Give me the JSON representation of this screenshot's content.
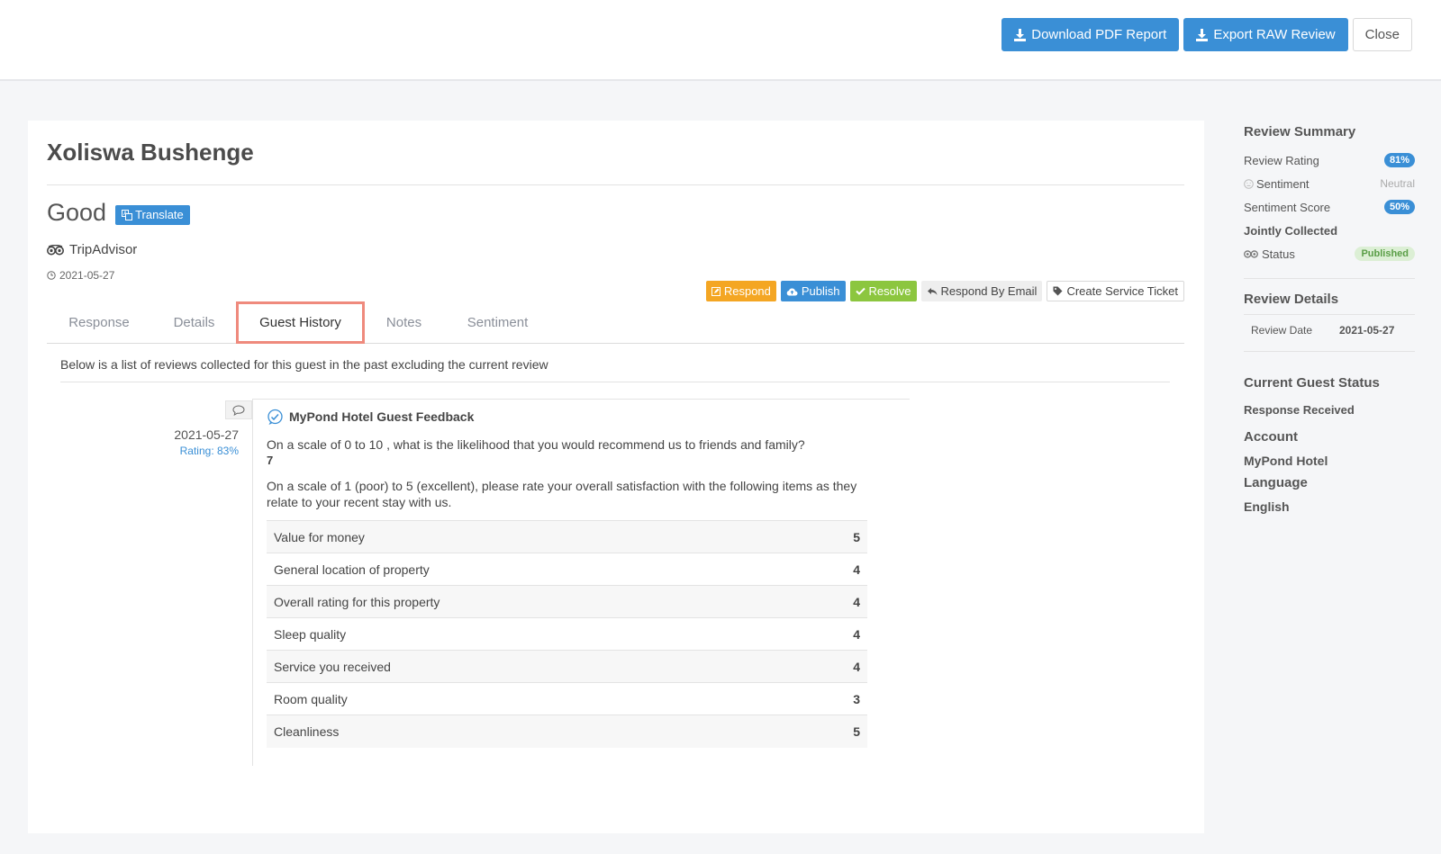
{
  "header": {
    "download_pdf_label": "Download PDF Report",
    "export_raw_label": "Export RAW Review",
    "close_label": "Close"
  },
  "review": {
    "guest_name": "Xoliswa Bushenge",
    "title": "Good",
    "translate_label": "Translate",
    "source": "TripAdvisor",
    "date": "2021-05-27"
  },
  "actions": {
    "respond": "Respond",
    "publish": "Publish",
    "resolve": "Resolve",
    "respond_email": "Respond By Email",
    "service_ticket": "Create Service Ticket"
  },
  "tabs": [
    {
      "label": "Response"
    },
    {
      "label": "Details"
    },
    {
      "label": "Guest History"
    },
    {
      "label": "Notes"
    },
    {
      "label": "Sentiment"
    }
  ],
  "guest_history": {
    "intro": "Below is a list of reviews collected for this guest in the past excluding the current review",
    "date": "2021-05-27",
    "rating": "Rating: 83%",
    "feedback_title": "MyPond Hotel Guest Feedback",
    "q1": "On a scale of 0 to 10 , what is the likelihood that you would recommend us to friends and family?",
    "a1": "7",
    "q2": "On a scale of 1 (poor) to 5 (excellent), please rate your overall satisfaction with the following items as they relate to your recent stay with us.",
    "ratings": [
      {
        "label": "Value for money",
        "value": "5"
      },
      {
        "label": "General location of property",
        "value": "4"
      },
      {
        "label": "Overall rating for this property",
        "value": "4"
      },
      {
        "label": "Sleep quality",
        "value": "4"
      },
      {
        "label": "Service you received",
        "value": "4"
      },
      {
        "label": "Room quality",
        "value": "3"
      },
      {
        "label": "Cleanliness",
        "value": "5"
      }
    ]
  },
  "summary": {
    "heading": "Review Summary",
    "rating_label": "Review Rating",
    "rating_value": "81%",
    "sentiment_label": "Sentiment",
    "sentiment_value": "Neutral",
    "score_label": "Sentiment Score",
    "score_value": "50%",
    "jointly": "Jointly Collected",
    "status_label": "Status",
    "status_value": "Published"
  },
  "details": {
    "heading": "Review Details",
    "date_label": "Review Date",
    "date_value": "2021-05-27"
  },
  "guest_status": {
    "heading": "Current Guest Status",
    "status": "Response Received",
    "account_label": "Account",
    "account_value": "MyPond Hotel",
    "language_label": "Language",
    "language_value": "English"
  },
  "colors": {
    "accent_blue": "#3a8fd6",
    "respond_orange": "#f4a623",
    "resolve_green": "#8cc63f",
    "tab_highlight": "#ef8a7d"
  }
}
